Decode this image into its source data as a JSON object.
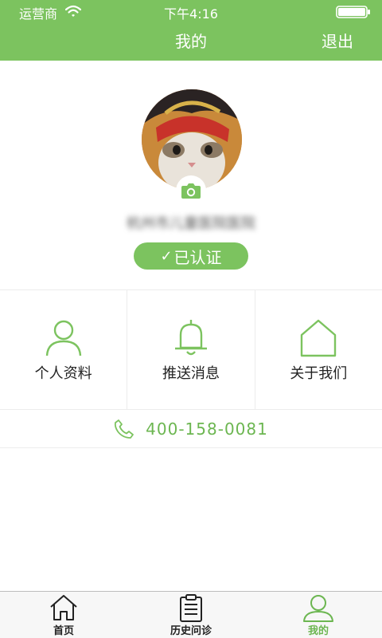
{
  "status_bar": {
    "carrier": "运营商",
    "time": "下午4:16",
    "wifi_icon": "wifi-icon",
    "battery_icon": "battery-icon"
  },
  "nav": {
    "title": "我的",
    "logout_label": "退出"
  },
  "profile": {
    "org_name": "杭州市儿童医院医院",
    "verified_label": "已认证",
    "camera_icon": "camera-icon"
  },
  "menu": {
    "items": [
      {
        "label": "个人资料",
        "icon": "person-icon"
      },
      {
        "label": "推送消息",
        "icon": "bell-icon"
      },
      {
        "label": "关于我们",
        "icon": "house-icon"
      }
    ]
  },
  "contact": {
    "phone": "400-158-0081",
    "icon": "phone-icon"
  },
  "tabbar": {
    "items": [
      {
        "label": "首页",
        "icon": "home-icon",
        "active": false
      },
      {
        "label": "历史问诊",
        "icon": "clipboard-icon",
        "active": false
      },
      {
        "label": "我的",
        "icon": "user-icon",
        "active": true
      }
    ]
  },
  "colors": {
    "brand": "#7cc35f",
    "accent_text": "#6cb651",
    "divider": "#ececec"
  }
}
